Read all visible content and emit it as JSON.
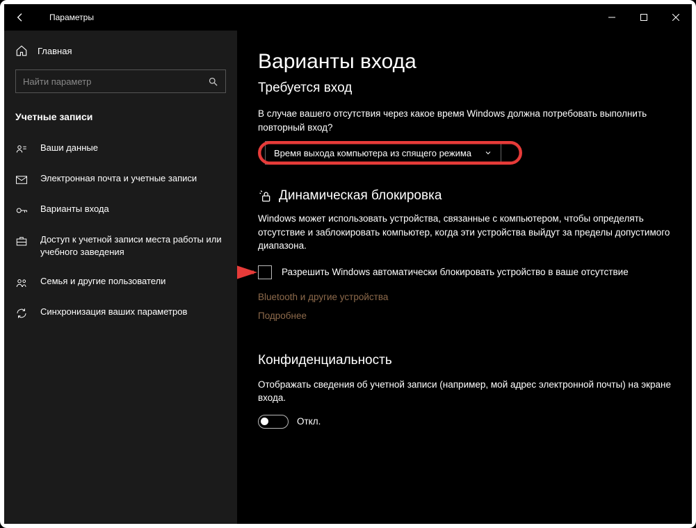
{
  "app": {
    "title": "Параметры"
  },
  "sidebar": {
    "home": "Главная",
    "search_placeholder": "Найти параметр",
    "section": "Учетные записи",
    "items": [
      {
        "label": "Ваши данные"
      },
      {
        "label": "Электронная почта и учетные записи"
      },
      {
        "label": "Варианты входа"
      },
      {
        "label": "Доступ к учетной записи места работы или учебного заведения"
      },
      {
        "label": "Семья и другие пользователи"
      },
      {
        "label": "Синхронизация ваших параметров"
      }
    ]
  },
  "main": {
    "title": "Варианты входа",
    "require_signin": {
      "heading": "Требуется вход",
      "desc": "В случае вашего отсутствия через какое время Windows должна потребовать выполнить повторный вход?",
      "dropdown": "Время выхода компьютера из спящего режима"
    },
    "dynamic_lock": {
      "heading": "Динамическая блокировка",
      "desc": "Windows может использовать устройства, связанные с компьютером, чтобы определять отсутствие и заблокировать компьютер, когда эти устройства выйдут за пределы допустимого диапазона.",
      "checkbox_label": "Разрешить Windows автоматически блокировать устройство в ваше отсутствие",
      "link1": "Bluetooth и другие устройства",
      "link2": "Подробнее"
    },
    "privacy": {
      "heading": "Конфиденциальность",
      "desc": "Отображать сведения об учетной записи (например, мой адрес электронной почты) на экране входа.",
      "toggle_label": "Откл."
    }
  }
}
